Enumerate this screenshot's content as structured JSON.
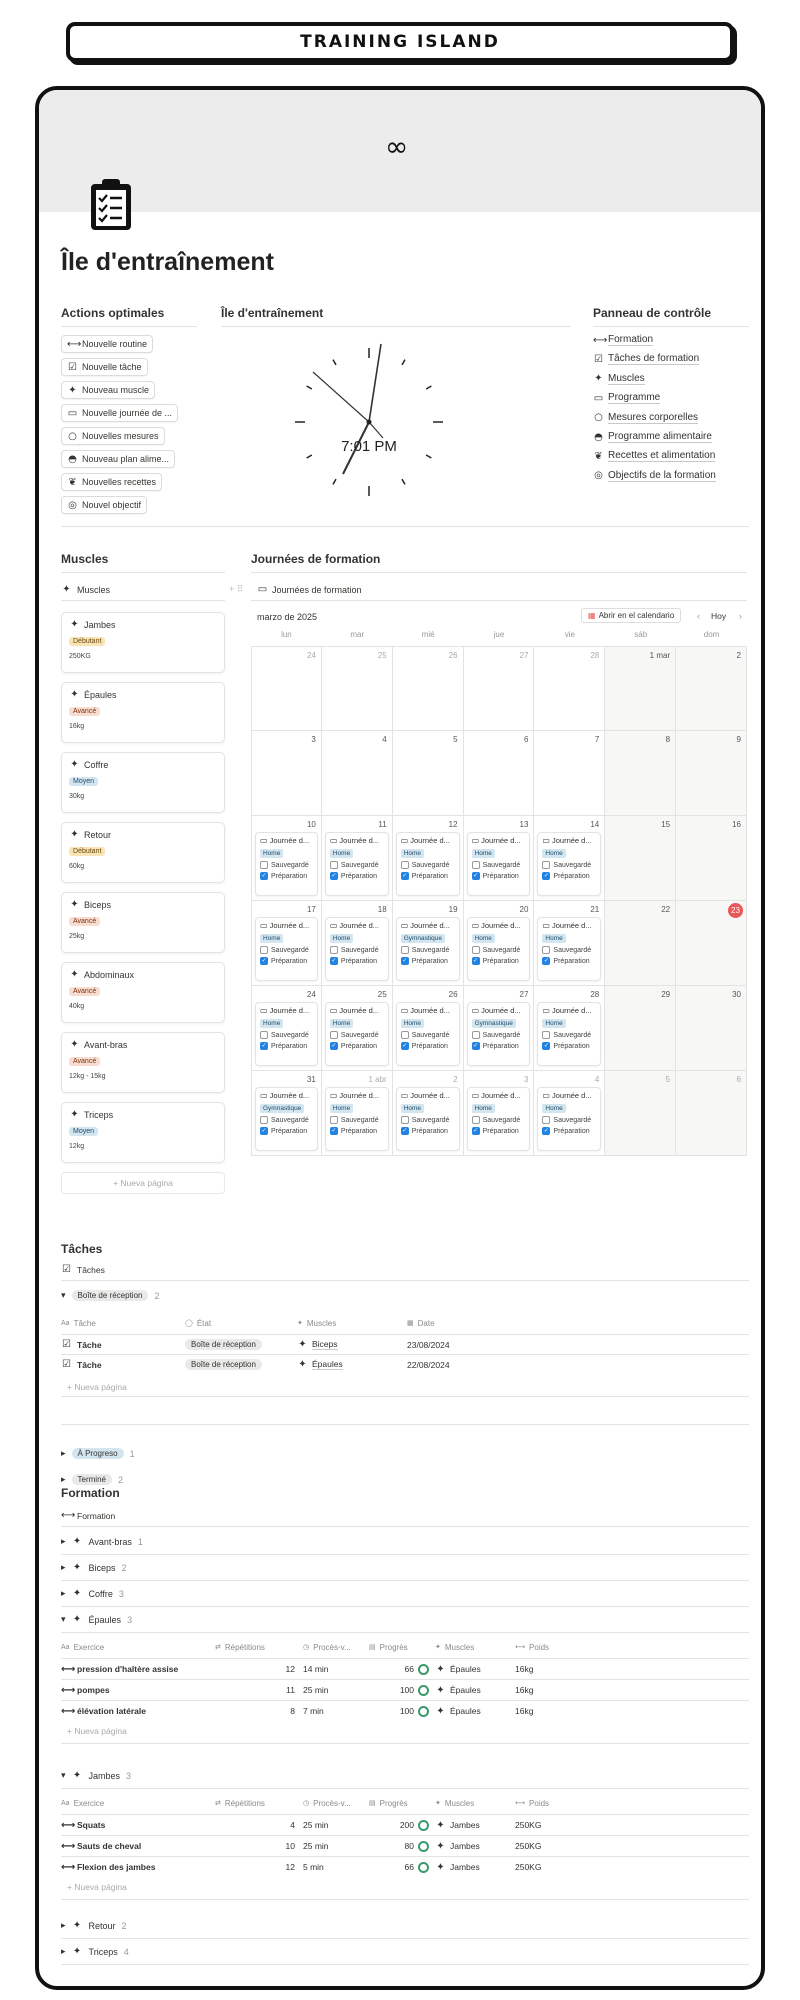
{
  "banner": "TRAINING ISLAND",
  "page_title": "Île d'entraînement",
  "actions": {
    "heading": "Actions optimales",
    "buttons": [
      {
        "icon": "dumbbell-icon",
        "glyph": "⟷",
        "label": "Nouvelle routine"
      },
      {
        "icon": "checkbox-icon",
        "glyph": "☑",
        "label": "Nouvelle tâche"
      },
      {
        "icon": "figure-icon",
        "glyph": "✦",
        "label": "Nouveau muscle"
      },
      {
        "icon": "calendar-icon",
        "glyph": "▭",
        "label": "Nouvelle journée de ..."
      },
      {
        "icon": "circle-icon",
        "glyph": "○",
        "label": "Nouvelles mesures"
      },
      {
        "icon": "food-icon",
        "glyph": "◓",
        "label": "Nouveau plan alime..."
      },
      {
        "icon": "carrot-icon",
        "glyph": "❦",
        "label": "Nouvelles recettes"
      },
      {
        "icon": "target-icon",
        "glyph": "◎",
        "label": "Nouvel objectif"
      }
    ]
  },
  "clock": {
    "heading": "Île d'entraînement",
    "time": "7:01 PM"
  },
  "dashboard": {
    "heading": "Panneau de contrôle",
    "items": [
      {
        "icon": "dumbbell-icon",
        "glyph": "⟷",
        "label": "Formation"
      },
      {
        "icon": "checkbox-icon",
        "glyph": "☑",
        "label": "Tâches de formation"
      },
      {
        "icon": "figure-icon",
        "glyph": "✦",
        "label": "Muscles"
      },
      {
        "icon": "calendar-icon",
        "glyph": "▭",
        "label": "Programme"
      },
      {
        "icon": "circle-icon",
        "glyph": "○",
        "label": "Mesures corporelles"
      },
      {
        "icon": "food-icon",
        "glyph": "◓",
        "label": "Programme alimentaire"
      },
      {
        "icon": "carrot-icon",
        "glyph": "❦",
        "label": "Recettes et alimentation"
      },
      {
        "icon": "target-icon",
        "glyph": "◎",
        "label": "Objectifs de la formation"
      }
    ]
  },
  "muscles": {
    "heading": "Muscles",
    "view": "Muscles",
    "new_page": "+ Nueva página",
    "cards": [
      {
        "name": "Jambes",
        "level": "Débutant",
        "cls": "deb",
        "weight": "250KG"
      },
      {
        "name": "Épaules",
        "level": "Avancé",
        "cls": "av",
        "weight": "16kg"
      },
      {
        "name": "Coffre",
        "level": "Moyen",
        "cls": "moy",
        "weight": "30kg"
      },
      {
        "name": "Retour",
        "level": "Débutant",
        "cls": "deb",
        "weight": "60kg"
      },
      {
        "name": "Biceps",
        "level": "Avancé",
        "cls": "av",
        "weight": "25kg"
      },
      {
        "name": "Abdominaux",
        "level": "Avancé",
        "cls": "av",
        "weight": "40kg"
      },
      {
        "name": "Avant-bras",
        "level": "Avancé",
        "cls": "av",
        "weight": "12kg - 15kg"
      },
      {
        "name": "Triceps",
        "level": "Moyen",
        "cls": "moy",
        "weight": "12kg"
      }
    ]
  },
  "calendar": {
    "heading": "Journées de formation",
    "view": "Journées de formation",
    "month": "marzo de 2025",
    "open_button": "Abrir en el calendario",
    "today_button": "Hoy",
    "weekdays": [
      "lun",
      "mar",
      "mié",
      "jue",
      "vie",
      "sáb",
      "dom"
    ],
    "event_title": "Journée d...",
    "saved_label": "Sauvegardé",
    "prep_label": "Préparation",
    "weeks": [
      {
        "days": [
          "24",
          "25",
          "26",
          "27",
          "28",
          "1 mar",
          "2"
        ],
        "grey": [
          true,
          true,
          true,
          true,
          true,
          false,
          false
        ],
        "events": [
          null,
          null,
          null,
          null,
          null,
          null,
          null
        ]
      },
      {
        "days": [
          "3",
          "4",
          "5",
          "6",
          "7",
          "8",
          "9"
        ],
        "grey": [
          false,
          false,
          false,
          false,
          false,
          false,
          false
        ],
        "events": [
          null,
          null,
          null,
          null,
          null,
          null,
          null
        ]
      },
      {
        "days": [
          "10",
          "11",
          "12",
          "13",
          "14",
          "15",
          "16"
        ],
        "grey": [
          false,
          false,
          false,
          false,
          false,
          false,
          false
        ],
        "events": [
          "Home",
          "Home",
          "Home",
          "Home",
          "Home",
          null,
          null
        ]
      },
      {
        "days": [
          "17",
          "18",
          "19",
          "20",
          "21",
          "22",
          "23"
        ],
        "grey": [
          false,
          false,
          false,
          false,
          false,
          false,
          false
        ],
        "events": [
          "Home",
          "Home",
          "Gymnastique",
          "Home",
          "Home",
          null,
          null
        ]
      },
      {
        "days": [
          "24",
          "25",
          "26",
          "27",
          "28",
          "29",
          "30"
        ],
        "grey": [
          false,
          false,
          false,
          false,
          false,
          false,
          false
        ],
        "events": [
          "Home",
          "Home",
          "Home",
          "Gymnastique",
          "Home",
          null,
          null
        ]
      },
      {
        "days": [
          "31",
          "1 abr",
          "2",
          "3",
          "4",
          "5",
          "6"
        ],
        "grey": [
          false,
          true,
          true,
          true,
          true,
          true,
          true
        ],
        "events": [
          "Gymnastique",
          "Home",
          "Home",
          "Home",
          "Home",
          null,
          null
        ]
      }
    ]
  },
  "tasks": {
    "heading": "Tâches",
    "view": "Tâches",
    "group_open": {
      "label": "Boîte de réception",
      "count": "2"
    },
    "columns": [
      "Tâche",
      "État",
      "Muscles",
      "Date"
    ],
    "rows": [
      {
        "name": "Tâche",
        "state": "Boîte de réception",
        "muscle": "Biceps",
        "date": "23/08/2024"
      },
      {
        "name": "Tâche",
        "state": "Boîte de réception",
        "muscle": "Épaules",
        "date": "22/08/2024"
      }
    ],
    "new_page": "+ Nueva página",
    "groups_closed": [
      {
        "label": "À Progreso",
        "count": "1"
      },
      {
        "label": "Terminé",
        "count": "2"
      }
    ]
  },
  "formation": {
    "heading": "Formation",
    "view": "Formation",
    "groups_top": [
      {
        "label": "Avant-bras",
        "count": "1"
      },
      {
        "label": "Biceps",
        "count": "2"
      },
      {
        "label": "Coffre",
        "count": "3"
      }
    ],
    "columns": [
      "Exercice",
      "Répétitions",
      "Procès-v...",
      "Progrès",
      "Muscles",
      "Poids"
    ],
    "epaules": {
      "label": "Épaules",
      "count": "3",
      "rows": [
        {
          "name": "pression d'haltère assise",
          "reps": "12",
          "time": "14 min",
          "prog": "66",
          "muscle": "Épaules",
          "weight": "16kg"
        },
        {
          "name": "pompes",
          "reps": "11",
          "time": "25 min",
          "prog": "100",
          "muscle": "Épaules",
          "weight": "16kg"
        },
        {
          "name": "élévation latérale",
          "reps": "8",
          "time": "7 min",
          "prog": "100",
          "muscle": "Épaules",
          "weight": "16kg"
        }
      ]
    },
    "jambes": {
      "label": "Jambes",
      "count": "3",
      "rows": [
        {
          "name": "Squats",
          "reps": "4",
          "time": "25 min",
          "prog": "200",
          "muscle": "Jambes",
          "weight": "250KG"
        },
        {
          "name": "Sauts de cheval",
          "reps": "10",
          "time": "25 min",
          "prog": "80",
          "muscle": "Jambes",
          "weight": "250KG"
        },
        {
          "name": "Flexion des jambes",
          "reps": "12",
          "time": "5 min",
          "prog": "66",
          "muscle": "Jambes",
          "weight": "250KG"
        }
      ]
    },
    "new_page": "+ Nueva página",
    "groups_bottom": [
      {
        "label": "Retour",
        "count": "2"
      },
      {
        "label": "Triceps",
        "count": "4"
      }
    ]
  }
}
